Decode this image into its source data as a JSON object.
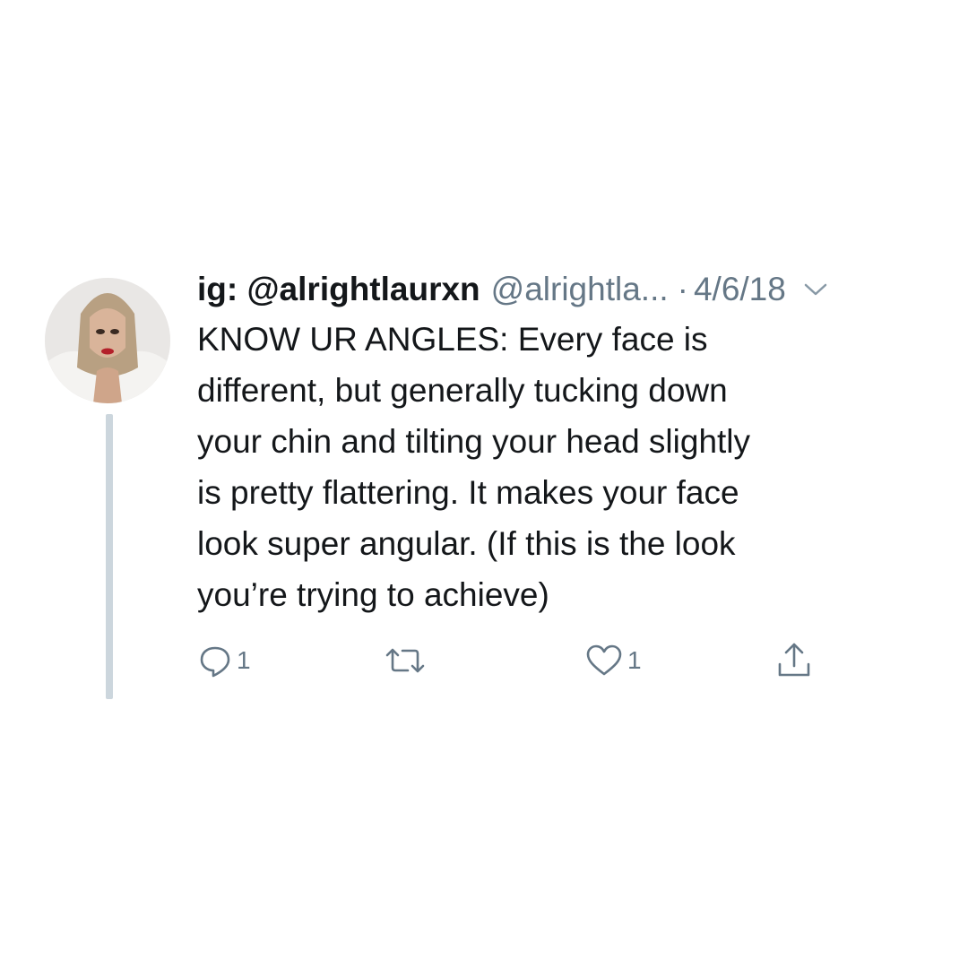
{
  "tweet": {
    "display_name": "ig: @alrightlaurxn",
    "handle": "@alrightla...",
    "separator": "·",
    "date": "4/6/18",
    "text": "KNOW UR ANGLES: Every face is\ndifferent, but generally tucking down\nyour chin and tilting your head slightly\nis pretty flattering. It makes your face\nlook super angular. (If this is the look\nyou’re trying to achieve)",
    "actions": {
      "reply": {
        "icon": "speech-bubble-icon",
        "count": "1"
      },
      "retweet": {
        "icon": "retweet-arrows-icon",
        "count": ""
      },
      "like": {
        "icon": "heart-icon",
        "count": "1"
      },
      "share": {
        "icon": "share-upload-icon",
        "count": ""
      }
    }
  },
  "colors": {
    "text": "#14171a",
    "secondary": "#657786",
    "thread_line": "#ccd6dd",
    "background": "#ffffff"
  }
}
